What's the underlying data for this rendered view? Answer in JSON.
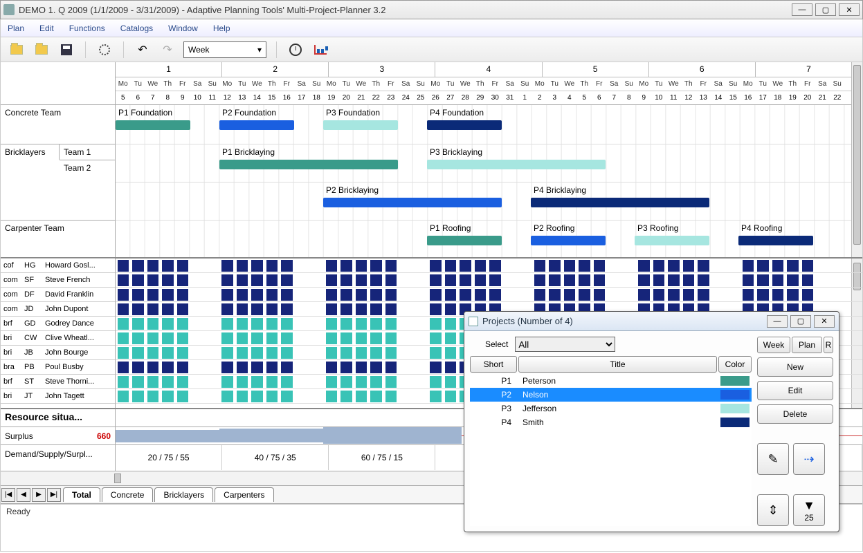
{
  "window": {
    "title": "DEMO   1. Q 2009 (1/1/2009 - 3/31/2009) - Adaptive Planning Tools' Multi-Project-Planner 3.2"
  },
  "menu": {
    "items": [
      "Plan",
      "Edit",
      "Functions",
      "Catalogs",
      "Window",
      "Help"
    ]
  },
  "toolbar": {
    "timescale": "Week"
  },
  "weeks": [
    "1",
    "2",
    "3",
    "4",
    "5",
    "6",
    "7"
  ],
  "days": [
    "Mo",
    "Tu",
    "We",
    "Th",
    "Fr",
    "Sa",
    "Su"
  ],
  "daynums": [
    [
      "5",
      "6",
      "7",
      "8",
      "9",
      "10",
      "11"
    ],
    [
      "12",
      "13",
      "14",
      "15",
      "16",
      "17",
      "18"
    ],
    [
      "19",
      "20",
      "21",
      "22",
      "23",
      "24",
      "25"
    ],
    [
      "26",
      "27",
      "28",
      "29",
      "30",
      "31",
      "1"
    ],
    [
      "2",
      "3",
      "4",
      "5",
      "6",
      "7",
      "8"
    ],
    [
      "9",
      "10",
      "11",
      "12",
      "13",
      "14",
      "15"
    ],
    [
      "16",
      "17",
      "18",
      "19",
      "20",
      "21",
      "22"
    ]
  ],
  "teams": {
    "concrete": "Concrete Team",
    "bricklayers": "Bricklayers",
    "team1": "Team 1",
    "team2": "Team 2",
    "carpenter": "Carpenter Team"
  },
  "tasks": {
    "p1_foundation": "P1 Foundation",
    "p2_foundation": "P2 Foundation",
    "p3_foundation": "P3 Foundation",
    "p4_foundation": "P4 Foundation",
    "p1_bricklaying": "P1 Bricklaying",
    "p2_bricklaying": "P2 Bricklaying",
    "p3_bricklaying": "P3 Bricklaying",
    "p4_bricklaying": "P4 Bricklaying",
    "p1_roofing": "P1 Roofing",
    "p2_roofing": "P2 Roofing",
    "p3_roofing": "P3 Roofing",
    "p4_roofing": "P4 Roofing"
  },
  "colors": {
    "p1": "#3a9b8a",
    "p2": "#1a5fe0",
    "p3": "#a6e6e0",
    "p4": "#0b2a78"
  },
  "resources": [
    {
      "g": "cof",
      "ini": "HG",
      "name": "Howard Gosl..."
    },
    {
      "g": "com",
      "ini": "SF",
      "name": "Steve French"
    },
    {
      "g": "com",
      "ini": "DF",
      "name": "David Franklin"
    },
    {
      "g": "com",
      "ini": "JD",
      "name": "John Dupont"
    },
    {
      "g": "brf",
      "ini": "GD",
      "name": "Godrey Dance"
    },
    {
      "g": "bri",
      "ini": "CW",
      "name": "Clive Wheatl..."
    },
    {
      "g": "bri",
      "ini": "JB",
      "name": "John Bourge"
    },
    {
      "g": "bra",
      "ini": "PB",
      "name": "Poul Busby"
    },
    {
      "g": "brf",
      "ini": "ST",
      "name": "Steve Thorni..."
    },
    {
      "g": "bri",
      "ini": "JT",
      "name": "John Tagett"
    }
  ],
  "resource_situation": {
    "header": "Resource situa...",
    "surplus_label": "Surplus",
    "surplus_value": "660",
    "dss_label": "Demand/Supply/Surpl...",
    "dss": [
      "20 / 75 / 55",
      "40 / 75 / 35",
      "60 / 75 / 15"
    ]
  },
  "tabs": {
    "items": [
      "Total",
      "Concrete",
      "Bricklayers",
      "Carpenters"
    ],
    "nav": [
      "|◀",
      "◀",
      "▶",
      "▶|"
    ]
  },
  "status": "Ready",
  "dialog": {
    "title": "Projects (Number of 4)",
    "select_label": "Select",
    "select_value": "All",
    "cols": {
      "short": "Short",
      "title": "Title",
      "color": "Color",
      "week": "Week",
      "plan": "Plan",
      "r": "R"
    },
    "rows": [
      {
        "short": "P1",
        "title": "Peterson",
        "color": "#3a9b8a"
      },
      {
        "short": "P2",
        "title": "Nelson",
        "color": "#1a5fe0"
      },
      {
        "short": "P3",
        "title": "Jefferson",
        "color": "#a6e6e0"
      },
      {
        "short": "P4",
        "title": "Smith",
        "color": "#0b2a78"
      }
    ],
    "buttons": {
      "new": "New",
      "edit": "Edit",
      "delete": "Delete"
    },
    "zoom": "25"
  }
}
